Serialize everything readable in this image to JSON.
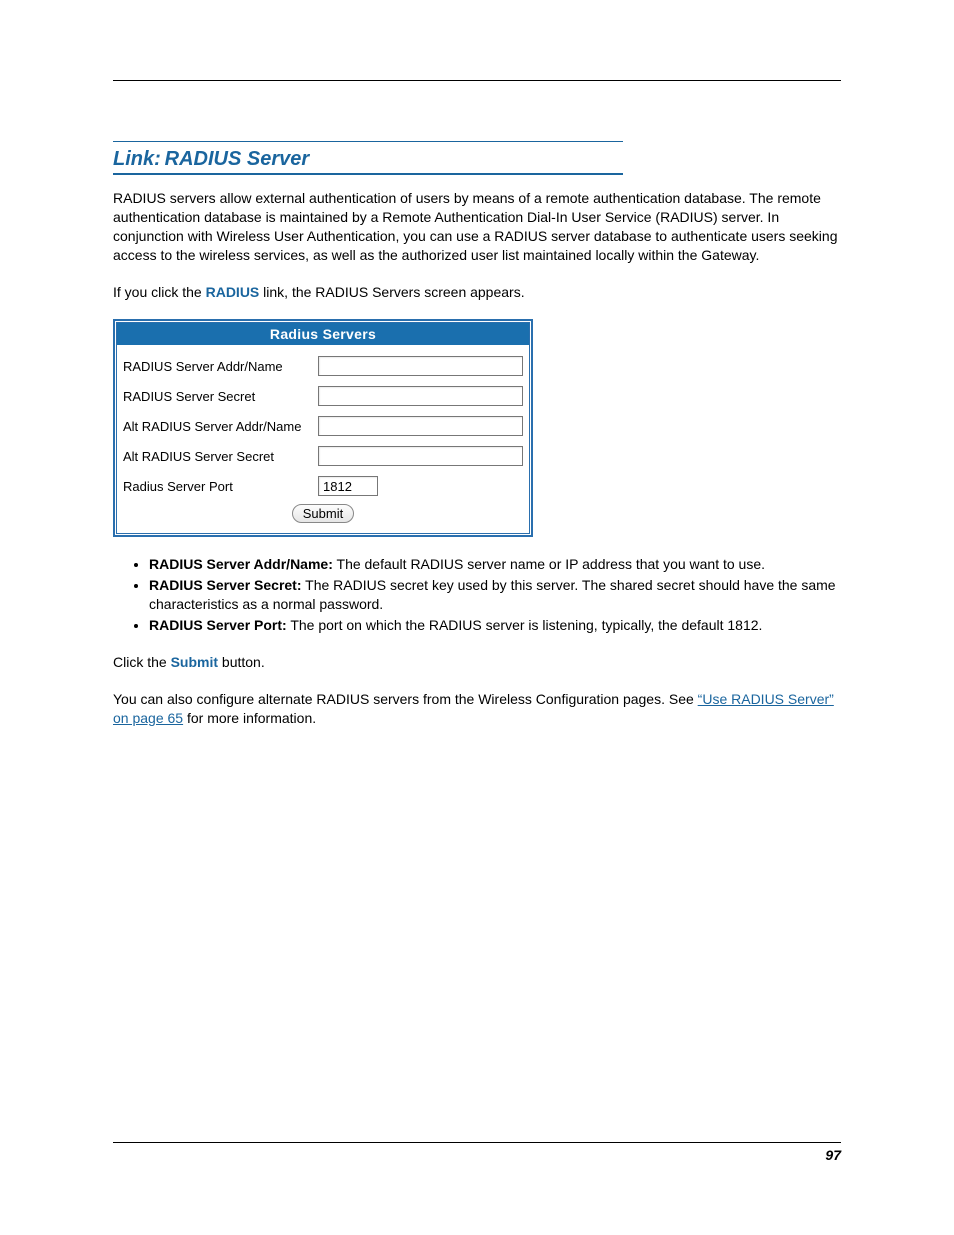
{
  "heading": {
    "prefix": "Link:",
    "title": "RADIUS Server"
  },
  "paragraphs": {
    "intro": "RADIUS servers allow external authentication of users by means of a remote authentication database. The remote authentication database is maintained by a Remote Authentication Dial-In User Service (RADIUS) server. In conjunction with Wireless User Authentication, you can use a RADIUS server database to authenticate users seeking access to the wireless services, as well as the authorized user list maintained locally within the Gateway.",
    "click_pre": "If you click the ",
    "click_link": "RADIUS",
    "click_post": " link, the RADIUS Servers screen appears.",
    "submit_pre": "Click the ",
    "submit_link": "Submit",
    "submit_post": " button.",
    "alt_pre": "You can also configure alternate RADIUS servers from the Wireless Configuration pages. See ",
    "alt_link": "“Use RADIUS Server” on page 65",
    "alt_post": " for more information."
  },
  "table": {
    "header": "Radius Servers",
    "rows": [
      {
        "label": "RADIUS Server Addr/Name",
        "value": "",
        "short": false
      },
      {
        "label": "RADIUS Server Secret",
        "value": "",
        "short": false
      },
      {
        "label": "Alt RADIUS Server Addr/Name",
        "value": "",
        "short": false
      },
      {
        "label": "Alt RADIUS Server Secret",
        "value": "",
        "short": false
      },
      {
        "label": "Radius Server Port",
        "value": "1812",
        "short": true
      }
    ],
    "submit_label": "Submit"
  },
  "bullets": [
    {
      "term": "RADIUS Server Addr/Name:",
      "desc": " The default RADIUS server name or IP address that you want to use."
    },
    {
      "term": "RADIUS Server Secret:",
      "desc": " The RADIUS secret key used by this server. The shared secret should have the same characteristics as a normal password."
    },
    {
      "term": "RADIUS Server Port:",
      "desc": " The port on which the RADIUS server is listening, typically, the default 1812."
    }
  ],
  "footer": {
    "page_number": "97"
  }
}
